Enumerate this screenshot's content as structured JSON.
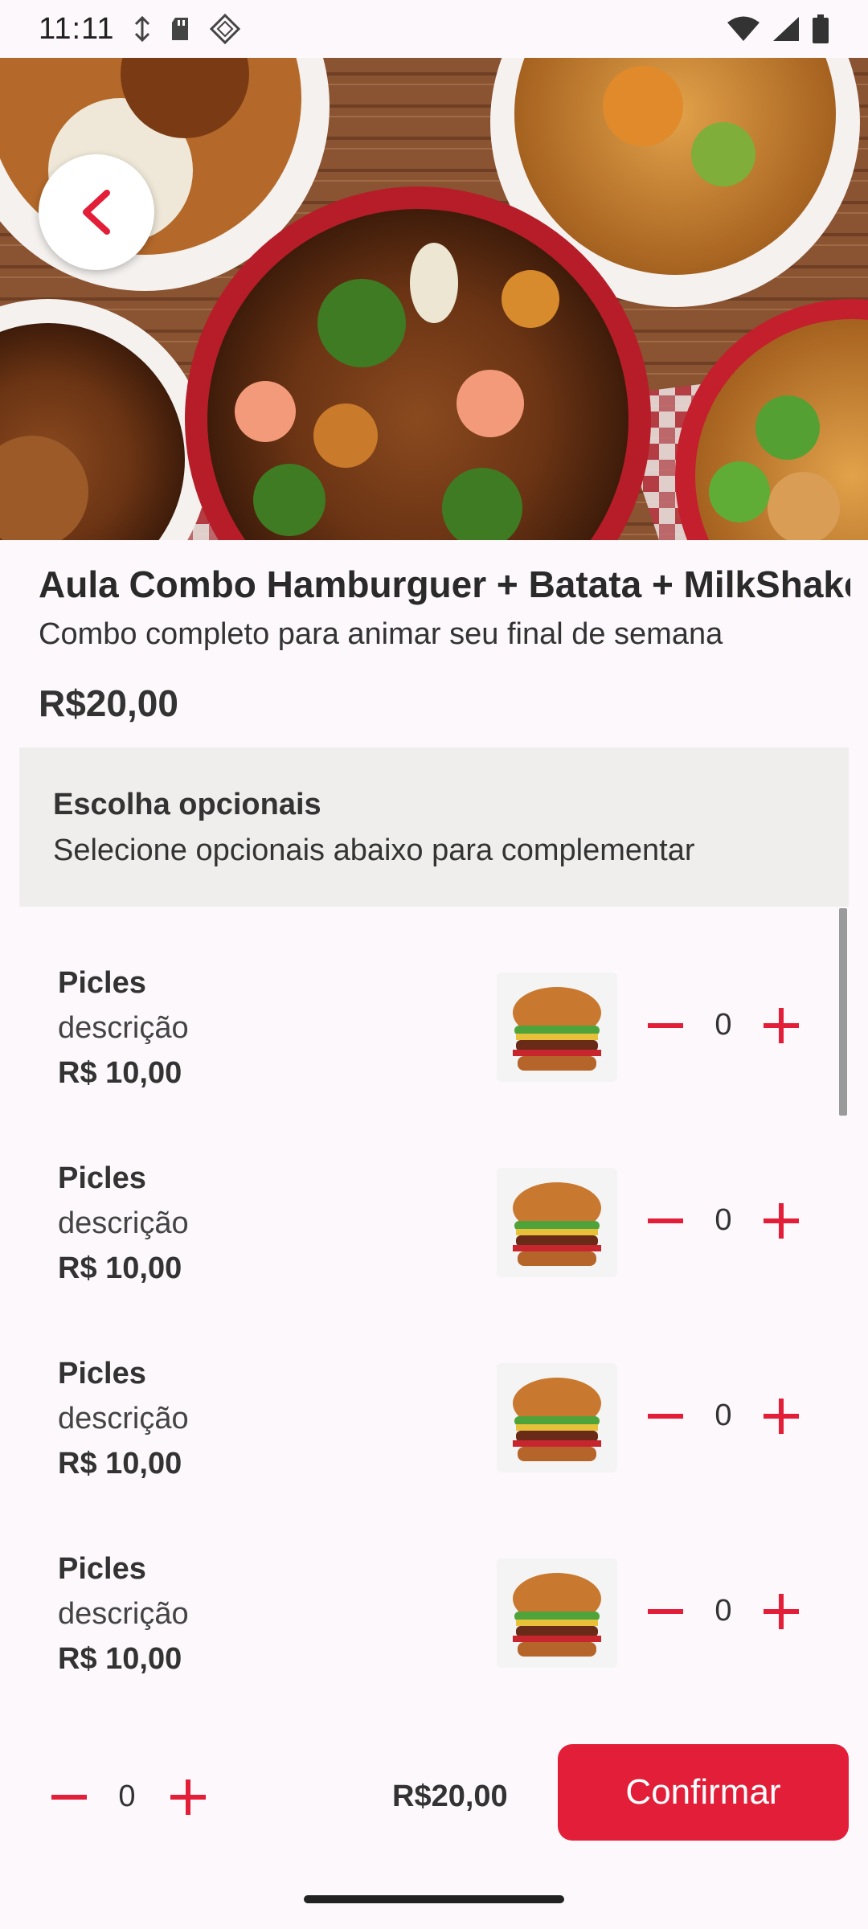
{
  "status_bar": {
    "time": "11:11"
  },
  "hero": {
    "alt": "Asian noodle dishes"
  },
  "product": {
    "title": "Aula Combo Hamburguer + Batata + MilkShake",
    "subtitle": "Combo completo para animar seu final de semana",
    "price": "R$20,00"
  },
  "optionals": {
    "title": "Escolha opcionais",
    "subtitle": "Selecione opcionais abaixo para complementar",
    "items": [
      {
        "name": "Picles",
        "description": "descrição",
        "price": "R$ 10,00",
        "quantity": "0"
      },
      {
        "name": "Picles",
        "description": "descrição",
        "price": "R$ 10,00",
        "quantity": "0"
      },
      {
        "name": "Picles",
        "description": "descrição",
        "price": "R$ 10,00",
        "quantity": "0"
      },
      {
        "name": "Picles",
        "description": "descrição",
        "price": "R$ 10,00",
        "quantity": "0"
      }
    ]
  },
  "bottom_bar": {
    "quantity": "0",
    "total": "R$20,00",
    "confirm_label": "Confirmar"
  },
  "colors": {
    "accent": "#e21e38",
    "background": "#fdf8fb",
    "panel": "#efeeec"
  }
}
